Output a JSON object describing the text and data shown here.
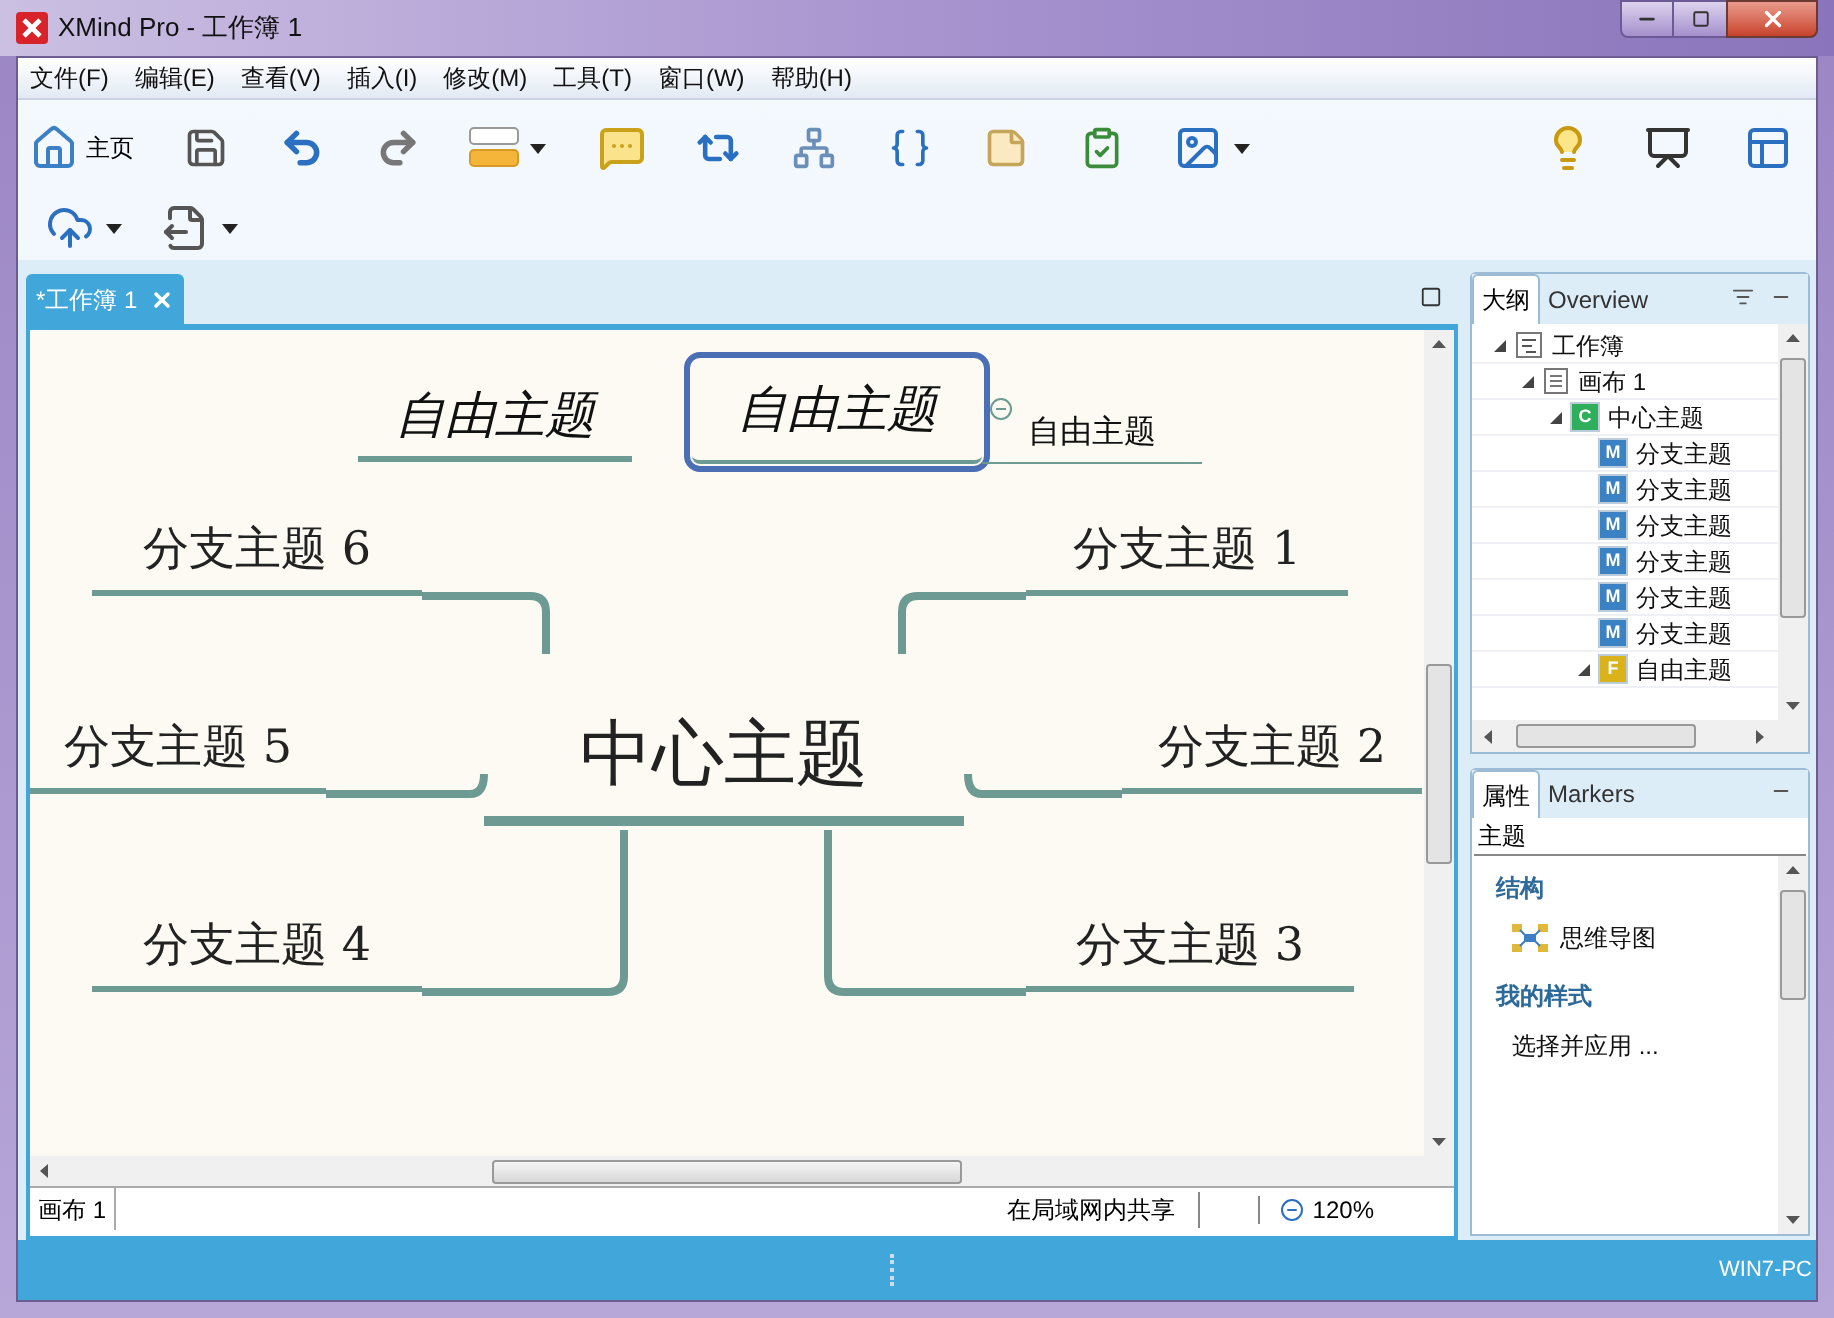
{
  "window": {
    "title": "XMind Pro - 工作簿 1"
  },
  "menu": [
    "文件(F)",
    "编辑(E)",
    "查看(V)",
    "插入(I)",
    "修改(M)",
    "工具(T)",
    "窗口(W)",
    "帮助(H)"
  ],
  "toolbar": {
    "home_label": "主页"
  },
  "editor_tab": {
    "label": "*工作簿 1"
  },
  "mind_map": {
    "central": "中心主题",
    "floating": [
      {
        "label": "自由主题",
        "selected": false
      },
      {
        "label": "自由主题",
        "selected": true,
        "children": [
          {
            "label": "自由主题"
          }
        ]
      }
    ],
    "branches": [
      {
        "label": "分支主题 6"
      },
      {
        "label": "分支主题 1"
      },
      {
        "label": "分支主题 5"
      },
      {
        "label": "分支主题 2"
      },
      {
        "label": "分支主题 4"
      },
      {
        "label": "分支主题 3"
      }
    ]
  },
  "outline": {
    "tabs": [
      {
        "label": "大纲",
        "selected": true
      },
      {
        "label": "Overview",
        "selected": false
      }
    ],
    "tree": [
      {
        "label": "工作簿",
        "kind": "workbook",
        "expanded": true,
        "children": [
          {
            "label": "画布 1",
            "kind": "sheet",
            "expanded": true,
            "children": [
              {
                "label": "中心主题",
                "kind": "central",
                "badge": "C",
                "expanded": true,
                "children": [
                  {
                    "label": "分支主题",
                    "kind": "main",
                    "badge": "M"
                  },
                  {
                    "label": "分支主题",
                    "kind": "main",
                    "badge": "M"
                  },
                  {
                    "label": "分支主题",
                    "kind": "main",
                    "badge": "M"
                  },
                  {
                    "label": "分支主题",
                    "kind": "main",
                    "badge": "M"
                  },
                  {
                    "label": "分支主题",
                    "kind": "main",
                    "badge": "M"
                  },
                  {
                    "label": "分支主题",
                    "kind": "main",
                    "badge": "M"
                  },
                  {
                    "label": "自由主题",
                    "kind": "floating",
                    "badge": "F",
                    "expanded": true
                  }
                ]
              }
            ]
          }
        ]
      }
    ]
  },
  "properties": {
    "tabs": [
      {
        "label": "属性",
        "selected": true
      },
      {
        "label": "Markers",
        "selected": false
      }
    ],
    "heading": "主题",
    "sections": [
      {
        "title": "结构",
        "items": [
          {
            "label": "思维导图",
            "kind": "structure"
          }
        ]
      },
      {
        "title": "我的样式",
        "items": [
          {
            "label": "选择并应用 ...",
            "kind": "action"
          }
        ]
      }
    ]
  },
  "status_bar": {
    "sheet_tab": "画布 1",
    "share": "在局域网内共享",
    "zoom": "120%"
  },
  "bottom_bar": {
    "user": "WIN7-PC"
  }
}
